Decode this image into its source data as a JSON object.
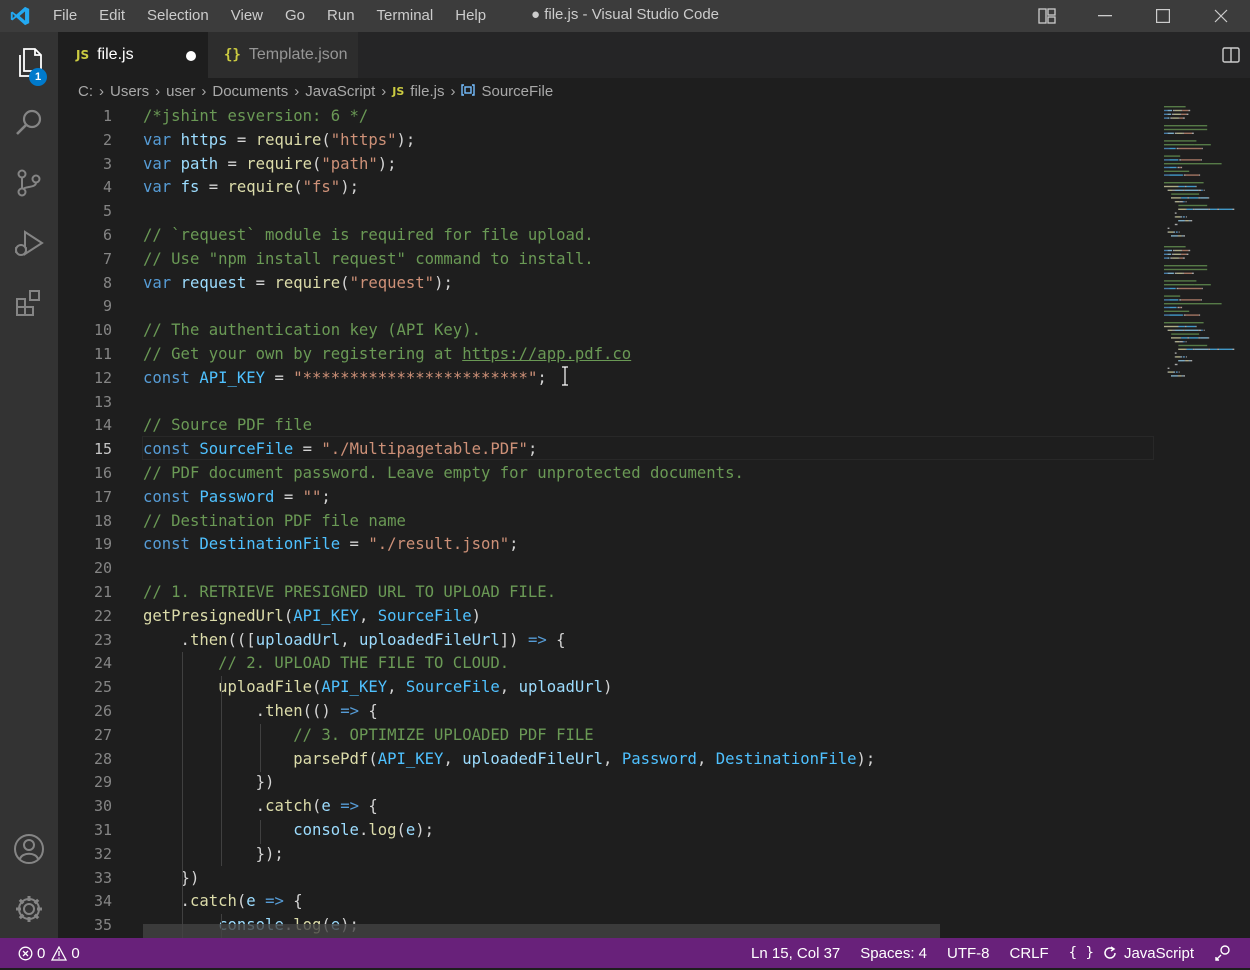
{
  "window": {
    "title": "● file.js - Visual Studio Code"
  },
  "menu": [
    "File",
    "Edit",
    "Selection",
    "View",
    "Go",
    "Run",
    "Terminal",
    "Help"
  ],
  "activity": {
    "explorer_badge": "1"
  },
  "tabs": [
    {
      "icon": "JS",
      "label": "file.js",
      "dirty": true,
      "active": true
    },
    {
      "icon": "{}",
      "label": "Template.json",
      "dirty": false,
      "active": false
    }
  ],
  "breadcrumb": {
    "parts": [
      "C:",
      "Users",
      "user",
      "Documents",
      "JavaScript"
    ],
    "file_icon": "JS",
    "file": "file.js",
    "symbol": "SourceFile"
  },
  "editor": {
    "current_line": 15,
    "lines": [
      {
        "n": "1",
        "code": [
          [
            "c",
            "/*jshint esversion: 6 */"
          ]
        ]
      },
      {
        "n": "2",
        "code": [
          [
            "k",
            "var "
          ],
          [
            "v",
            "https"
          ],
          [
            "p",
            " = "
          ],
          [
            "f",
            "require"
          ],
          [
            "p",
            "("
          ],
          [
            "s",
            "\"https\""
          ],
          [
            "p",
            ");"
          ]
        ]
      },
      {
        "n": "3",
        "code": [
          [
            "k",
            "var "
          ],
          [
            "v",
            "path"
          ],
          [
            "p",
            " = "
          ],
          [
            "f",
            "require"
          ],
          [
            "p",
            "("
          ],
          [
            "s",
            "\"path\""
          ],
          [
            "p",
            ");"
          ]
        ]
      },
      {
        "n": "4",
        "code": [
          [
            "k",
            "var "
          ],
          [
            "v",
            "fs"
          ],
          [
            "p",
            " = "
          ],
          [
            "f",
            "require"
          ],
          [
            "p",
            "("
          ],
          [
            "s",
            "\"fs\""
          ],
          [
            "p",
            ");"
          ]
        ]
      },
      {
        "n": "5",
        "code": []
      },
      {
        "n": "6",
        "code": [
          [
            "c",
            "// `request` module is required for file upload."
          ]
        ]
      },
      {
        "n": "7",
        "code": [
          [
            "c",
            "// Use \"npm install request\" command to install."
          ]
        ]
      },
      {
        "n": "8",
        "code": [
          [
            "k",
            "var "
          ],
          [
            "v",
            "request"
          ],
          [
            "p",
            " = "
          ],
          [
            "f",
            "require"
          ],
          [
            "p",
            "("
          ],
          [
            "s",
            "\"request\""
          ],
          [
            "p",
            ");"
          ]
        ]
      },
      {
        "n": "9",
        "code": []
      },
      {
        "n": "10",
        "code": [
          [
            "c",
            "// The authentication key (API Key)."
          ]
        ]
      },
      {
        "n": "11",
        "code": [
          [
            "c",
            "// Get your own by registering at "
          ],
          [
            "cu",
            "https://app.pdf.co"
          ]
        ]
      },
      {
        "n": "12",
        "code": [
          [
            "k",
            "const "
          ],
          [
            "cn",
            "API_KEY"
          ],
          [
            "p",
            " = "
          ],
          [
            "s",
            "\"************************\""
          ],
          [
            "p",
            ";"
          ]
        ]
      },
      {
        "n": "13",
        "code": []
      },
      {
        "n": "14",
        "code": [
          [
            "c",
            "// Source PDF file"
          ]
        ]
      },
      {
        "n": "15",
        "code": [
          [
            "k",
            "const "
          ],
          [
            "cn",
            "SourceFile"
          ],
          [
            "p",
            " = "
          ],
          [
            "s",
            "\"./Multipagetable.PDF\""
          ],
          [
            "p",
            ";"
          ]
        ]
      },
      {
        "n": "16",
        "code": [
          [
            "c",
            "// PDF document password. Leave empty for unprotected documents."
          ]
        ]
      },
      {
        "n": "17",
        "code": [
          [
            "k",
            "const "
          ],
          [
            "cn",
            "Password"
          ],
          [
            "p",
            " = "
          ],
          [
            "s",
            "\"\""
          ],
          [
            "p",
            ";"
          ]
        ]
      },
      {
        "n": "18",
        "code": [
          [
            "c",
            "// Destination PDF file name"
          ]
        ]
      },
      {
        "n": "19",
        "code": [
          [
            "k",
            "const "
          ],
          [
            "cn",
            "DestinationFile"
          ],
          [
            "p",
            " = "
          ],
          [
            "s",
            "\"./result.json\""
          ],
          [
            "p",
            ";"
          ]
        ]
      },
      {
        "n": "20",
        "code": []
      },
      {
        "n": "21",
        "code": [
          [
            "c",
            "// 1. RETRIEVE PRESIGNED URL TO UPLOAD FILE."
          ]
        ]
      },
      {
        "n": "22",
        "code": [
          [
            "f",
            "getPresignedUrl"
          ],
          [
            "p",
            "("
          ],
          [
            "cn",
            "API_KEY"
          ],
          [
            "p",
            ", "
          ],
          [
            "cn",
            "SourceFile"
          ],
          [
            "p",
            ")"
          ]
        ]
      },
      {
        "n": "23",
        "code": [
          [
            "p",
            "    ."
          ],
          [
            "f",
            "then"
          ],
          [
            "p",
            "(("
          ],
          [
            "p",
            "["
          ],
          [
            "v",
            "uploadUrl"
          ],
          [
            "p",
            ", "
          ],
          [
            "v",
            "uploadedFileUrl"
          ],
          [
            "p",
            "]) "
          ],
          [
            "k",
            "=>"
          ],
          [
            "p",
            " {"
          ]
        ]
      },
      {
        "n": "24",
        "code": [
          [
            "c",
            "        // 2. UPLOAD THE FILE TO CLOUD."
          ]
        ]
      },
      {
        "n": "25",
        "code": [
          [
            "p",
            "        "
          ],
          [
            "f",
            "uploadFile"
          ],
          [
            "p",
            "("
          ],
          [
            "cn",
            "API_KEY"
          ],
          [
            "p",
            ", "
          ],
          [
            "cn",
            "SourceFile"
          ],
          [
            "p",
            ", "
          ],
          [
            "v",
            "uploadUrl"
          ],
          [
            "p",
            ")"
          ]
        ]
      },
      {
        "n": "26",
        "code": [
          [
            "p",
            "            ."
          ],
          [
            "f",
            "then"
          ],
          [
            "p",
            "(() "
          ],
          [
            "k",
            "=>"
          ],
          [
            "p",
            " {"
          ]
        ]
      },
      {
        "n": "27",
        "code": [
          [
            "c",
            "                // 3. OPTIMIZE UPLOADED PDF FILE"
          ]
        ]
      },
      {
        "n": "28",
        "code": [
          [
            "p",
            "                "
          ],
          [
            "f",
            "parsePdf"
          ],
          [
            "p",
            "("
          ],
          [
            "cn",
            "API_KEY"
          ],
          [
            "p",
            ", "
          ],
          [
            "v",
            "uploadedFileUrl"
          ],
          [
            "p",
            ", "
          ],
          [
            "cn",
            "Password"
          ],
          [
            "p",
            ", "
          ],
          [
            "cn",
            "DestinationFile"
          ],
          [
            "p",
            ");"
          ]
        ]
      },
      {
        "n": "29",
        "code": [
          [
            "p",
            "            })"
          ]
        ]
      },
      {
        "n": "30",
        "code": [
          [
            "p",
            "            ."
          ],
          [
            "f",
            "catch"
          ],
          [
            "p",
            "("
          ],
          [
            "v",
            "e"
          ],
          [
            "p",
            " "
          ],
          [
            "k",
            "=>"
          ],
          [
            "p",
            " {"
          ]
        ]
      },
      {
        "n": "31",
        "code": [
          [
            "p",
            "                "
          ],
          [
            "v",
            "console"
          ],
          [
            "p",
            "."
          ],
          [
            "f",
            "log"
          ],
          [
            "p",
            "("
          ],
          [
            "v",
            "e"
          ],
          [
            "p",
            ");"
          ]
        ]
      },
      {
        "n": "32",
        "code": [
          [
            "p",
            "            });"
          ]
        ]
      },
      {
        "n": "33",
        "code": [
          [
            "p",
            "    })"
          ]
        ]
      },
      {
        "n": "34",
        "code": [
          [
            "p",
            "    ."
          ],
          [
            "f",
            "catch"
          ],
          [
            "p",
            "("
          ],
          [
            "v",
            "e"
          ],
          [
            "p",
            " "
          ],
          [
            "k",
            "=>"
          ],
          [
            "p",
            " {"
          ]
        ]
      },
      {
        "n": "35",
        "code": [
          [
            "p",
            "        "
          ],
          [
            "v",
            "console"
          ],
          [
            "p",
            "."
          ],
          [
            "f",
            "log"
          ],
          [
            "p",
            "("
          ],
          [
            "v",
            "e"
          ],
          [
            "p",
            ");"
          ]
        ]
      }
    ]
  },
  "status": {
    "errors": "0",
    "warnings": "0",
    "position": "Ln 15, Col 37",
    "spaces": "Spaces: 4",
    "encoding": "UTF-8",
    "eol": "CRLF",
    "language_icon": "{ }",
    "language": "JavaScript"
  },
  "colors": {
    "statusbar": "#68217a",
    "accent": "#007acc",
    "js_icon": "#cbcb41"
  }
}
